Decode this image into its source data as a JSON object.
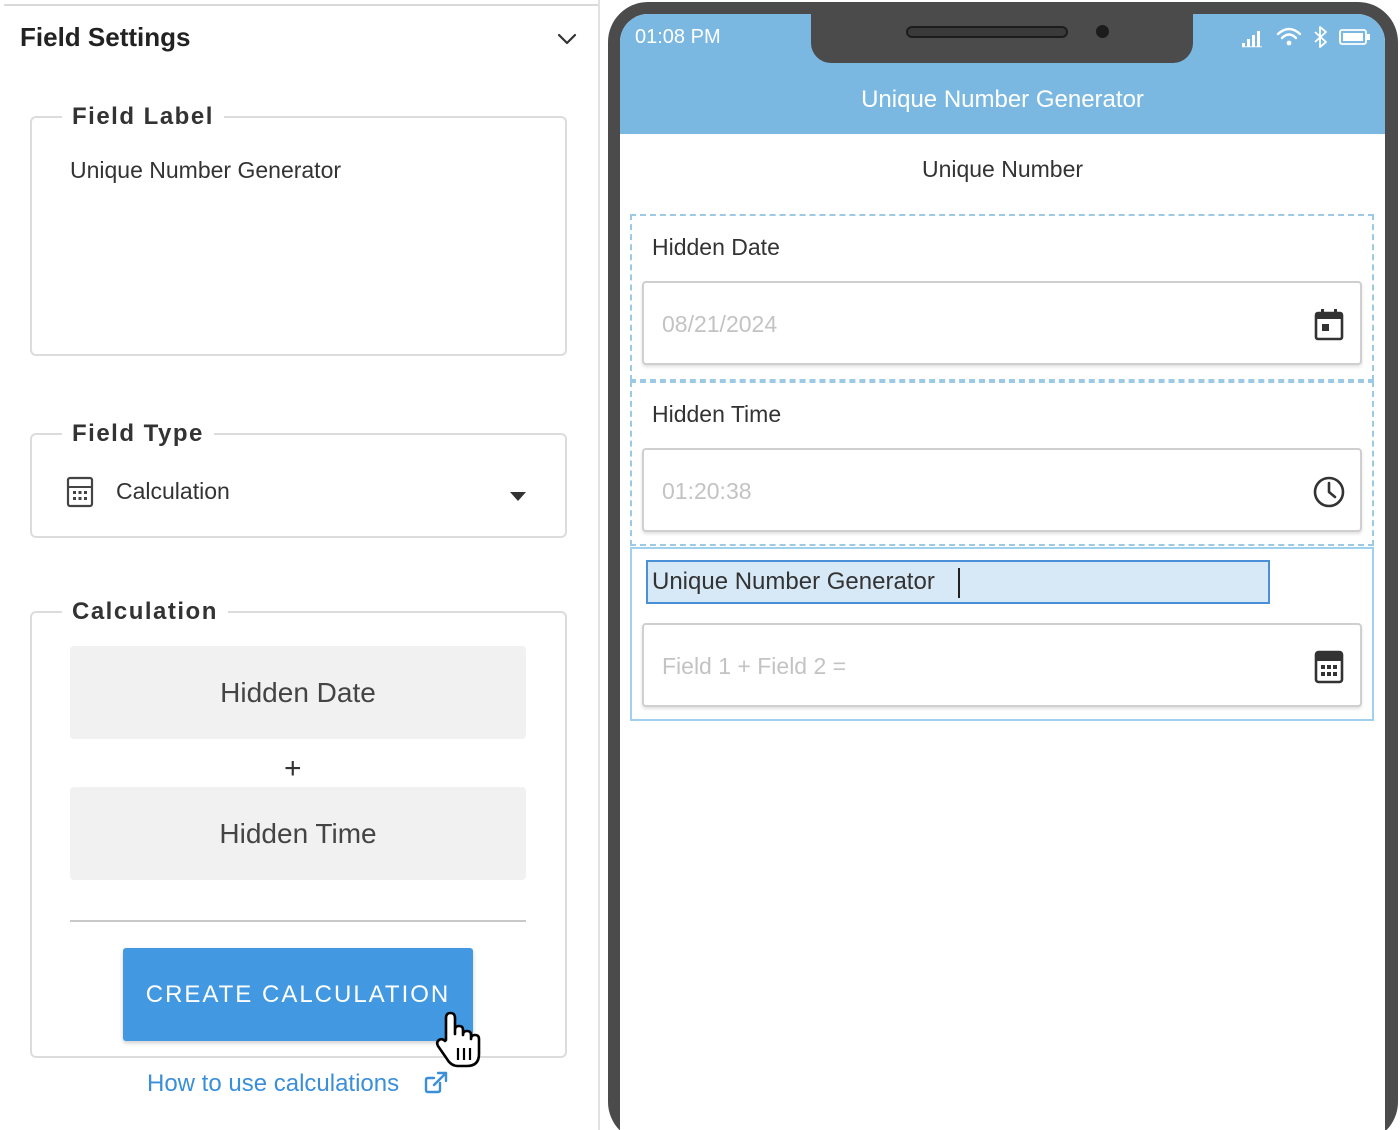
{
  "settings_panel": {
    "title": "Field Settings",
    "collapse_icon": "chevron-down-icon",
    "field_label": {
      "legend": "Field Label",
      "value": "Unique Number Generator"
    },
    "field_type": {
      "legend": "Field Type",
      "icon": "calculator-icon",
      "selected": "Calculation",
      "dropdown_icon": "caret-down-icon"
    },
    "calculation": {
      "legend": "Calculation",
      "operand_1": "Hidden Date",
      "operator": "+",
      "operand_2": "Hidden Time",
      "create_button": "CREATE CALCULATION"
    },
    "help_link": "How to use calculations",
    "accent_color": "#4299e1"
  },
  "phone_preview": {
    "status_time": "01:08 PM",
    "status_icons": [
      "signal-icon",
      "wifi-icon",
      "bluetooth-icon",
      "battery-icon"
    ],
    "app_title": "Unique Number Generator",
    "header_color": "#7ab8e2",
    "form_heading": "Unique Number",
    "fields": {
      "hidden_date": {
        "label": "Hidden Date",
        "value": "08/21/2024",
        "icon": "calendar-icon"
      },
      "hidden_time": {
        "label": "Hidden Time",
        "value": "01:20:38",
        "icon": "clock-icon"
      },
      "calculation": {
        "label": "Unique Number Generator",
        "placeholder": "Field 1 + Field 2 =",
        "icon": "calculator-icon"
      }
    }
  }
}
